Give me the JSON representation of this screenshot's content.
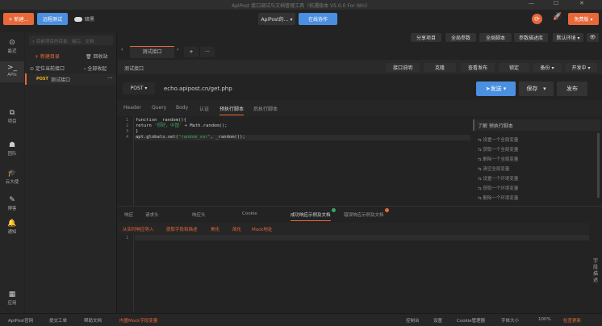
{
  "window": {
    "title": "ApiPost 接口调试与文档管理工具（机遇版本 V5.0.0 For Win）",
    "min": "—",
    "max": "☐",
    "close": "✕"
  },
  "toolbar": {
    "new": "+ 新建…",
    "remote": "远程测试",
    "dark_toggle": "暗黑",
    "project": "ApiPost的… ▾",
    "collab": "在线协作",
    "upgrade": "免费版 ▾",
    "accent": "#e8683a",
    "primary": "#4a8fe0"
  },
  "toolbar2": {
    "share": "分享项目",
    "global_params": "全局参数",
    "global_script": "全局脚本",
    "param_lib": "参数描述库",
    "env": "默认环境 ▾"
  },
  "rail": [
    {
      "icon": "clock-icon",
      "glyph": "⊙",
      "label": "最近"
    },
    {
      "icon": "terminal-icon",
      "glyph": ">_",
      "label": "APIs"
    },
    {
      "icon": "project-icon",
      "glyph": "⧉",
      "label": "项目"
    },
    {
      "icon": "team-icon",
      "glyph": "☗",
      "label": "团队"
    },
    {
      "icon": "ambassador-icon",
      "glyph": "🎓",
      "label": "云大使"
    },
    {
      "icon": "blog-icon",
      "glyph": "✎",
      "label": "博客"
    },
    {
      "icon": "bell-icon",
      "glyph": "🔔",
      "label": "通知"
    },
    {
      "icon": "apps-icon",
      "glyph": "▦",
      "label": "应用"
    }
  ],
  "sidebar": {
    "search_placeholder": "目前项目的目录、接口、文档",
    "new_folder": "+ 新建目录",
    "recycle": "回收站",
    "locate": "定位当前接口",
    "collapse": "› 全部收起",
    "items": [
      {
        "method": "POST",
        "name": "测试接口"
      }
    ]
  },
  "tabs": {
    "items": [
      "测试接口"
    ],
    "add": "+",
    "more": "···"
  },
  "breadcrumb": "测试接口",
  "actions": [
    "接口说明",
    "克隆",
    "查看发布",
    "锁定",
    "备份 ▾",
    "开发中 ▾"
  ],
  "request": {
    "method": "POST ▾",
    "url": "echo.apipost.cn/get.php",
    "send": "发送",
    "save": "保存",
    "publish": "发布"
  },
  "subtabs": [
    "Header",
    "Query",
    "Body",
    "认证",
    "预执行脚本",
    "后执行脚本"
  ],
  "subtab_active": 4,
  "code": {
    "lines": [
      "1",
      "2",
      "3",
      "4"
    ],
    "l1": "function _random(){",
    "l2a": "    return ",
    "l2s": "'你好，中国'",
    "l2b": " + Math.random();",
    "l3": "}",
    "l4a": "apt.globals.set(",
    "l4s": "\"random_var\"",
    "l4b": ", _random());"
  },
  "help": {
    "title": "了解 预执行脚本",
    "items": [
      "设置一个全局变量",
      "获取一个全局变量",
      "删除一个全局变量",
      "清空全局变量",
      "设置一个环境变量",
      "获取一个环境变量",
      "删除一个环境变量"
    ]
  },
  "response": {
    "tabs": [
      "响应",
      "请求头",
      "响应头",
      "Cookie",
      "成功响应示例及文档",
      "错误响应示例及文档"
    ],
    "tools": [
      "从实时响应导入",
      "提取字段和描述",
      "美化",
      "简化",
      "Mock地址"
    ],
    "line": "1",
    "field_desc": "字段描述"
  },
  "statusbar": {
    "left": [
      "ApiPost官网",
      "提交工单",
      "帮助文档",
      "内置Mock字段变量"
    ],
    "right": [
      "控制台",
      "设置",
      "Cookie管理器",
      "字体大小",
      "100%",
      "检查更新"
    ]
  }
}
